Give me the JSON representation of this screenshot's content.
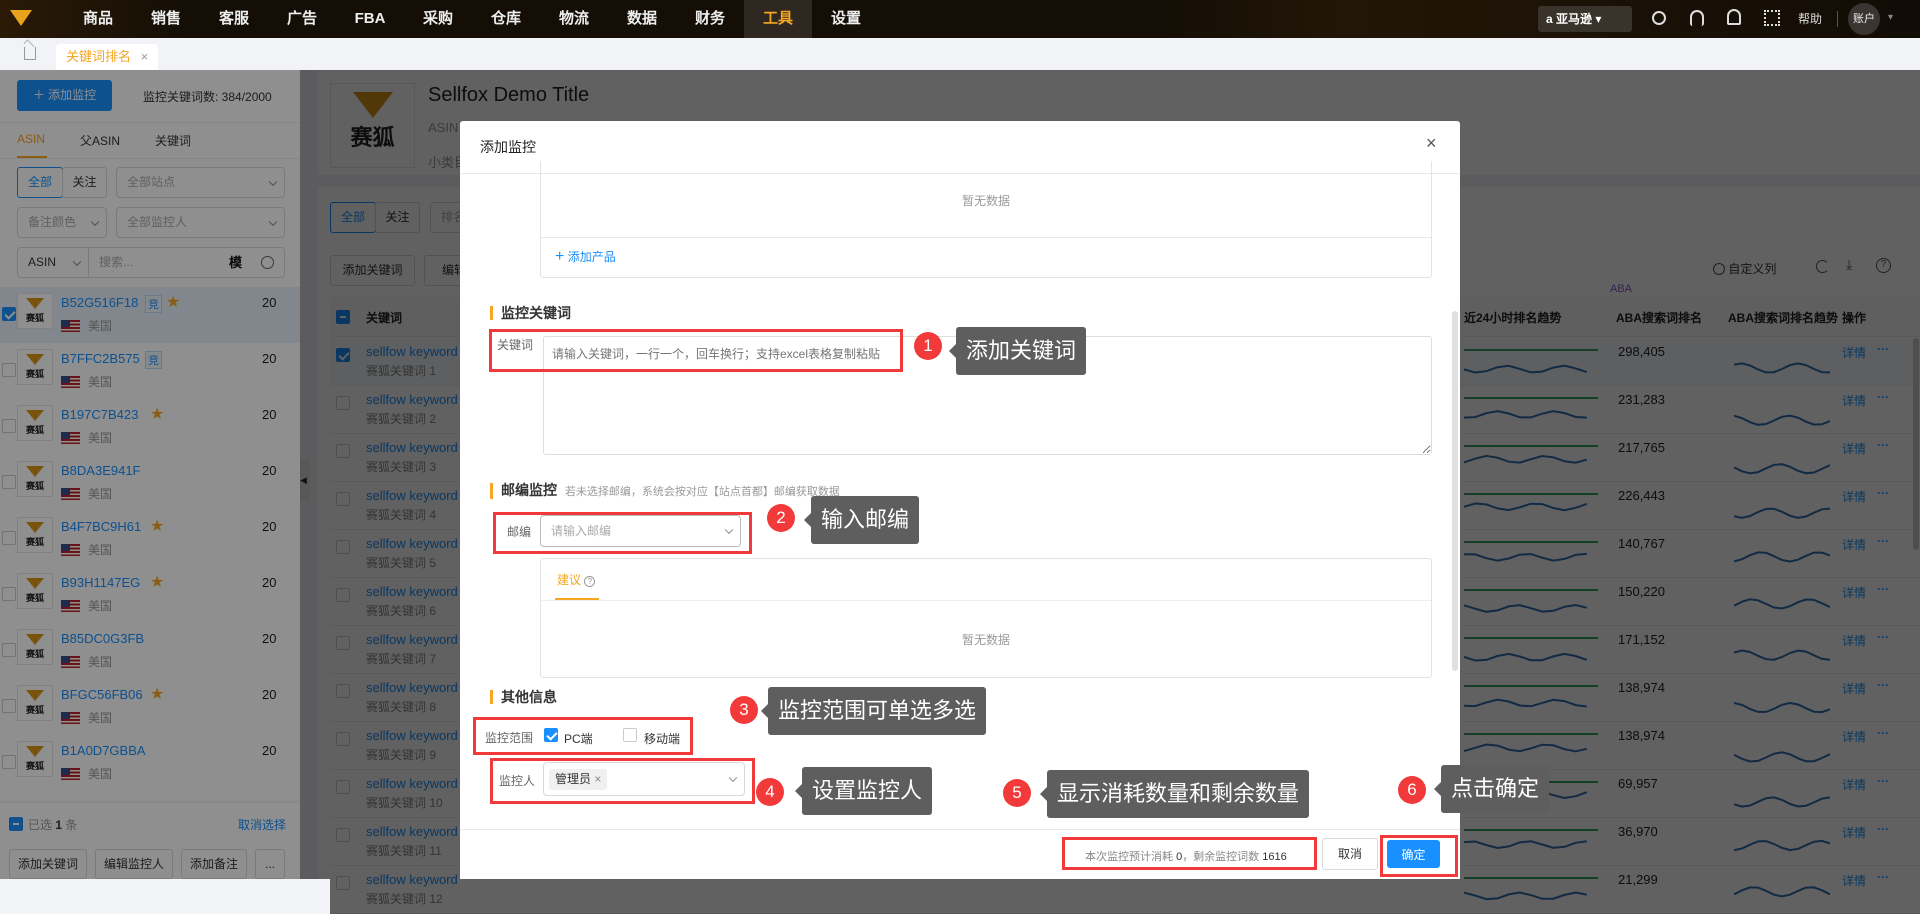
{
  "topnav": {
    "items": [
      "商品",
      "销售",
      "客服",
      "广告",
      "FBA",
      "采购",
      "仓库",
      "物流",
      "数据",
      "财务",
      "工具",
      "设置"
    ],
    "active_index": 10,
    "marketplace": "亚马逊",
    "help": "帮助",
    "account": "账户"
  },
  "tabs": {
    "current": "关键词排名"
  },
  "sidebar": {
    "add_button": "添加监控",
    "quota_label": "监控关键词数: 384/2000",
    "tabs": [
      "ASIN",
      "父ASIN",
      "关键词"
    ],
    "filter_all": "全部",
    "filter_follow": "关注",
    "site_select": "全部站点",
    "note_color_select": "备注颜色",
    "monitor_person_select": "全部监控人",
    "search_type": "ASIN",
    "search_placeholder": "搜索...",
    "fuzzy_label": "模",
    "items": [
      {
        "asin": "B52G516F18",
        "tag": "竞",
        "star": true,
        "country": "美国",
        "count": "20",
        "checked": true
      },
      {
        "asin": "B7FFC2B575",
        "tag": "竞",
        "star": false,
        "country": "美国",
        "count": "20",
        "checked": false
      },
      {
        "asin": "B197C7B423",
        "tag": "",
        "star": true,
        "country": "美国",
        "count": "20",
        "checked": false
      },
      {
        "asin": "B8DA3E941F",
        "tag": "",
        "star": false,
        "country": "美国",
        "count": "20",
        "checked": false
      },
      {
        "asin": "B4F7BC9H61",
        "tag": "",
        "star": true,
        "country": "美国",
        "count": "20",
        "checked": false
      },
      {
        "asin": "B93H1147EG",
        "tag": "",
        "star": true,
        "country": "美国",
        "count": "20",
        "checked": false
      },
      {
        "asin": "B85DC0G3FB",
        "tag": "",
        "star": false,
        "country": "美国",
        "count": "20",
        "checked": false
      },
      {
        "asin": "BFGC56FB06",
        "tag": "",
        "star": true,
        "country": "美国",
        "count": "20",
        "checked": false
      },
      {
        "asin": "B1A0D7GBBA",
        "tag": "",
        "star": false,
        "country": "美国",
        "count": "20",
        "checked": false
      }
    ],
    "thumb_text": "赛狐",
    "selected_prefix": "已选",
    "selected_count": "1",
    "selected_suffix": "条",
    "cancel_selection": "取消选择",
    "bottom_buttons": [
      "添加关键词",
      "编辑监控人",
      "添加备注",
      "..."
    ]
  },
  "main": {
    "product_title": "Sellfox Demo Title",
    "asin_label": "ASIN",
    "category_label": "小类目",
    "thumb_text": "赛狐",
    "filter_all": "全部",
    "filter_follow": "关注",
    "rank_select": "排名",
    "add_keyword_button": "添加关键词",
    "edit_button": "编辑",
    "custom_columns": "自定义列",
    "aba_group": "ABA",
    "columns": {
      "keyword": "关键词",
      "trend24": "近24小时排名趋势",
      "aba_rank": "ABA搜索词排名",
      "aba_trend": "ABA搜索词排名趋势",
      "ops": "操作"
    },
    "rows": [
      {
        "kw": "sellfow keyword",
        "sub": "赛狐关键词 1",
        "aba": "298,405",
        "checked": true
      },
      {
        "kw": "sellfow keyword",
        "sub": "赛狐关键词 2",
        "aba": "231,283"
      },
      {
        "kw": "sellfow keyword",
        "sub": "赛狐关键词 3",
        "aba": "217,765"
      },
      {
        "kw": "sellfow keyword",
        "sub": "赛狐关键词 4",
        "aba": "226,443"
      },
      {
        "kw": "sellfow keyword",
        "sub": "赛狐关键词 5",
        "aba": "140,767"
      },
      {
        "kw": "sellfow keyword",
        "sub": "赛狐关键词 6",
        "aba": "150,220"
      },
      {
        "kw": "sellfow keyword",
        "sub": "赛狐关键词 7",
        "aba": "171,152"
      },
      {
        "kw": "sellfow keyword",
        "sub": "赛狐关键词 8",
        "aba": "138,974"
      },
      {
        "kw": "sellfow keyword",
        "sub": "赛狐关键词 9",
        "aba": "138,974"
      },
      {
        "kw": "sellfow keyword",
        "sub": "赛狐关键词 10",
        "aba": "69,957"
      },
      {
        "kw": "sellfow keyword",
        "sub": "赛狐关键词 11",
        "aba": "36,970"
      },
      {
        "kw": "sellfow keyword",
        "sub": "赛狐关键词 12",
        "aba": "21,299"
      }
    ],
    "detail_link": "详情",
    "more": "···"
  },
  "modal": {
    "title": "添加监控",
    "products_empty": "暂无数据",
    "add_product": "添加产品",
    "keyword_section": "监控关键词",
    "keyword_label": "关键词",
    "keyword_placeholder": "请输入关键词，一行一个，回车换行；支持excel表格复制粘贴",
    "zip_section": "邮编监控",
    "zip_hint": "若未选择邮编，系统会按对应【站点首都】邮编获取数据",
    "zip_label": "邮编",
    "zip_placeholder": "请输入邮编",
    "suggest_tab": "建议",
    "suggest_empty": "暂无数据",
    "other_section": "其他信息",
    "scope_label": "监控范围",
    "scope_pc": "PC端",
    "scope_pc_checked": true,
    "scope_mobile": "移动端",
    "scope_mobile_checked": false,
    "person_label": "监控人",
    "person_tag": "管理员",
    "footer_cost_prefix": "本次监控预计消耗",
    "footer_cost": "0",
    "footer_remaining_prefix": "，剩余监控词数",
    "footer_remaining": "1616",
    "cancel": "取消",
    "confirm": "确定"
  },
  "annotations": [
    {
      "n": "1",
      "text": "添加关键词"
    },
    {
      "n": "2",
      "text": "输入邮编"
    },
    {
      "n": "3",
      "text": "监控范围可单选多选"
    },
    {
      "n": "4",
      "text": "设置监控人"
    },
    {
      "n": "5",
      "text": "显示消耗数量和剩余数量"
    },
    {
      "n": "6",
      "text": "点击确定"
    }
  ],
  "colors": {
    "brand": "#f5a623",
    "primary": "#1890ff",
    "annotation": "#f23a3a"
  }
}
